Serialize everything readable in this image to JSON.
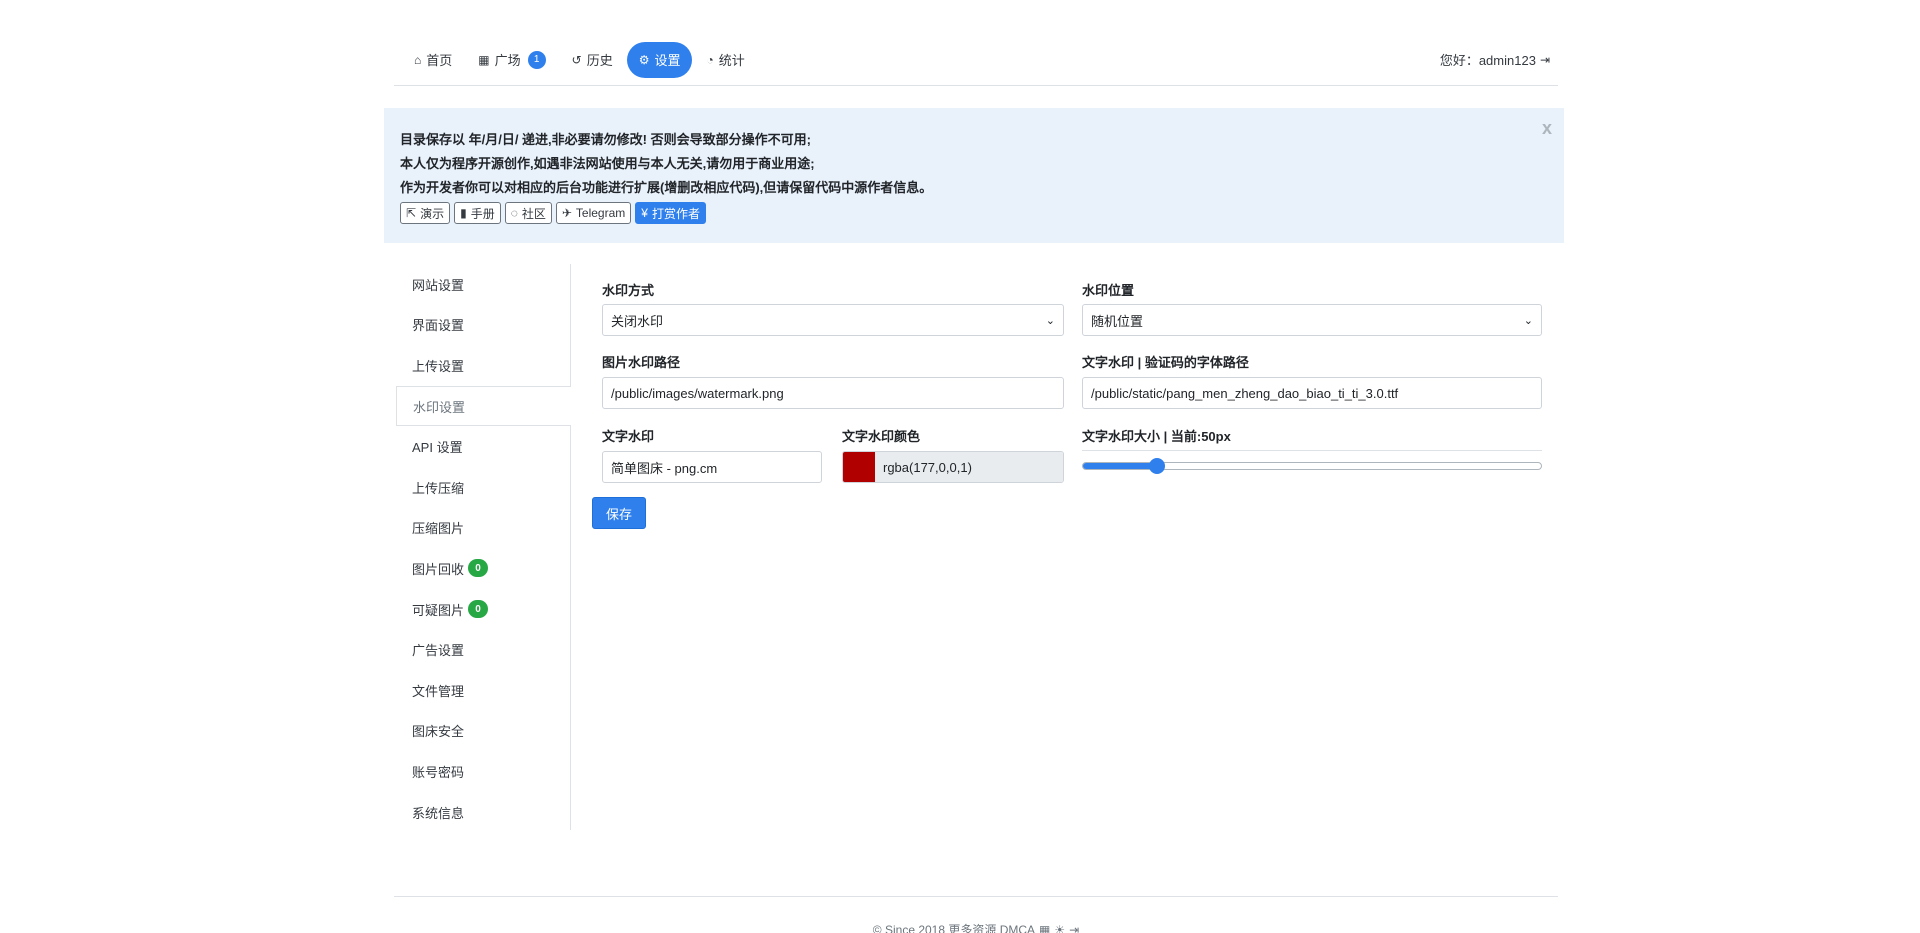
{
  "nav": {
    "items": [
      {
        "icon": "home-icon",
        "glyph": "⌂",
        "label": "首页"
      },
      {
        "icon": "grid-icon",
        "glyph": "▦",
        "label": "广场",
        "badge": "1"
      },
      {
        "icon": "history-icon",
        "glyph": "↺",
        "label": "历史"
      },
      {
        "icon": "gears-icon",
        "glyph": "⚙",
        "label": "设置"
      },
      {
        "icon": "pie-chart-icon",
        "glyph": "◔",
        "label": "统计"
      }
    ],
    "greeting": "您好：admin123"
  },
  "alert": {
    "lines": [
      "目录保存以 年/月/日/ 递进,非必要请勿修改! 否则会导致部分操作不可用;",
      "本人仅为程序开源创作,如遇非法网站使用与本人无关,请勿用于商业用途;",
      "作为开发者你可以对相应的后台功能进行扩展(增删改相应代码),但请保留代码中源作者信息。"
    ],
    "close": "x",
    "buttons": [
      {
        "glyph": "⇱",
        "label": "演示"
      },
      {
        "glyph": "▮",
        "label": "手册"
      },
      {
        "glyph": "◌",
        "label": "社区"
      },
      {
        "glyph": "✈",
        "label": "Telegram"
      },
      {
        "glyph": "¥",
        "label": "打赏作者"
      }
    ]
  },
  "sidebar": {
    "items": [
      {
        "label": "网站设置"
      },
      {
        "label": "界面设置"
      },
      {
        "label": "上传设置"
      },
      {
        "label": "水印设置"
      },
      {
        "label": "API 设置"
      },
      {
        "label": "上传压缩"
      },
      {
        "label": "压缩图片"
      },
      {
        "label": "图片回收",
        "badge": "0"
      },
      {
        "label": "可疑图片",
        "badge": "0"
      },
      {
        "label": "广告设置"
      },
      {
        "label": "文件管理"
      },
      {
        "label": "图床安全"
      },
      {
        "label": "账号密码"
      },
      {
        "label": "系统信息"
      }
    ]
  },
  "form": {
    "watermark_mode_label": "水印方式",
    "watermark_mode_value": "关闭水印",
    "watermark_position_label": "水印位置",
    "watermark_position_value": "随机位置",
    "image_watermark_path_label": "图片水印路径",
    "image_watermark_path_value": "/public/images/watermark.png",
    "font_path_label": "文字水印 | 验证码的字体路径",
    "font_path_value": "/public/static/pang_men_zheng_dao_biao_ti_ti_3.0.ttf",
    "text_watermark_label": "文字水印",
    "text_watermark_value": "简单图床 - png.cm",
    "text_color_label": "文字水印颜色",
    "text_color_value": "rgba(177,0,0,1)",
    "text_color_hex": "#b10000",
    "text_size_label": "文字水印大小 | 当前:50px",
    "text_size_fraction": 0.16,
    "save_label": "保存"
  },
  "footer": {
    "text": "© Since 2018 更多资源 DMCA"
  },
  "colors": {
    "accent": "#2f80ed",
    "success": "#28a745",
    "alert_bg": "#e9f1fb"
  }
}
